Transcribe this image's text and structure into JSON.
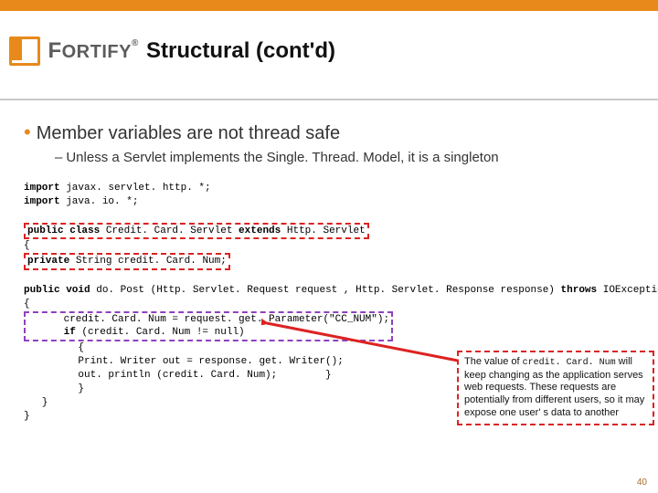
{
  "logo": {
    "text": "ORTIFY",
    "cap": "F",
    "reg": "®"
  },
  "title": "Structural (cont'd)",
  "bullet1": "Member variables are not thread safe",
  "bullet2": "Unless a Servlet implements the Single. Thread. Model, it is a singleton",
  "code": {
    "l1a": "import",
    "l1b": " javax. servlet. http. *;",
    "l2a": "import",
    "l2b": " java. io. *;",
    "l3a": "public class",
    "l3b": " Credit. Card. Servlet ",
    "l3c": "extends",
    "l3d": " Http. Servlet",
    "l4": "{",
    "l5a": "private",
    "l5b": " String credit. Card. Num;",
    "l6a": "public void",
    "l6b": " do. Post (Http. Servlet. Request request , Http. Servlet. Response response) ",
    "l6c": "throws",
    "l6d": " IOException",
    "l7": "{",
    "l8": "      credit. Card. Num = request. get. Parameter(\"CC_NUM\");",
    "l9a": "      if",
    "l9b": " (credit. Card. Num != null)",
    "l10": "         {",
    "l11": "         Print. Writer out = response. get. Writer();",
    "l12": "         out. println (credit. Card. Num);        }",
    "l13": "         }",
    "l14": "   }",
    "l15": "}"
  },
  "callout": {
    "t1": "The value of ",
    "mono": "credit. Card. Num",
    "t2": " will keep changing as the application serves web requests.  These requests are potentially from different users, so it may expose one user' s data to another"
  },
  "pagenum": "40"
}
